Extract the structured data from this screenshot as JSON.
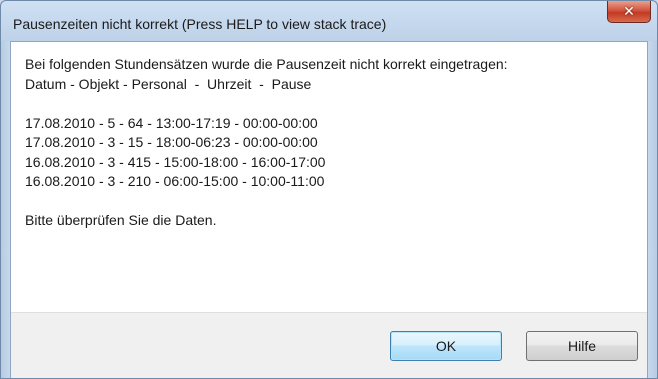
{
  "dialog": {
    "title": "Pausenzeiten nicht korrekt (Press HELP to view stack trace)",
    "close_icon": "close-icon"
  },
  "message": {
    "intro": "Bei folgenden Stundensätzen wurde die Pausenzeit nicht korrekt eingetragen:",
    "header": "Datum - Objekt - Personal  -  Uhrzeit  -  Pause",
    "entries": [
      "17.08.2010 - 5 - 64 - 13:00-17:19 - 00:00-00:00",
      "17.08.2010 - 3 - 15 - 18:00-06:23 - 00:00-00:00",
      "16.08.2010 - 3 - 415 - 15:00-18:00 - 16:00-17:00",
      "16.08.2010 - 3 - 210 - 06:00-15:00 - 10:00-11:00"
    ],
    "footer": "Bitte überprüfen Sie die Daten."
  },
  "buttons": {
    "ok": "OK",
    "help": "Hilfe"
  }
}
